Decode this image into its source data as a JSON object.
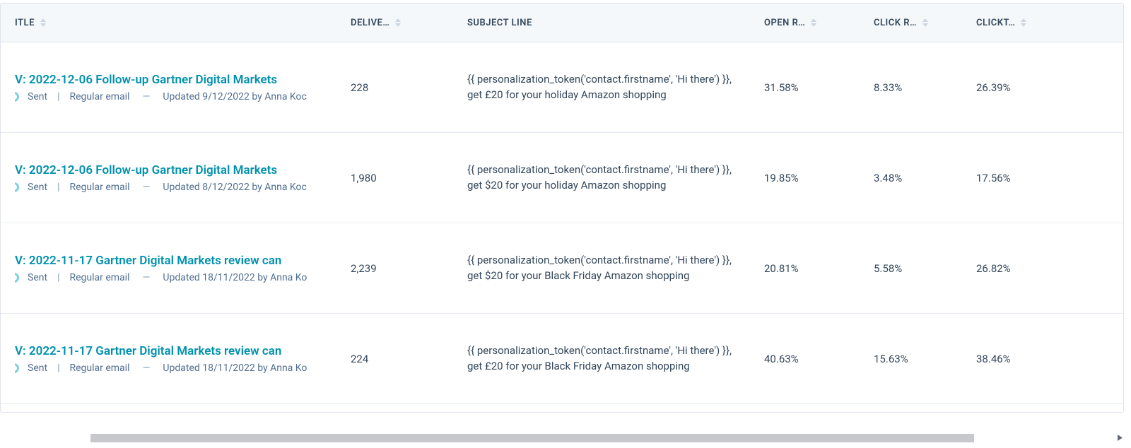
{
  "columns": {
    "title": "ITLE",
    "deliv": "DELIVE…",
    "subject": "SUBJECT LINE",
    "open": "OPEN R…",
    "click": "CLICK R…",
    "clickt": "CLICKT…"
  },
  "rows": [
    {
      "title": "V: 2022-12-06 Follow-up Gartner Digital Markets",
      "status": "Sent",
      "type": "Regular email",
      "updated": "Updated 9/12/2022 by Anna Koc",
      "delivered": "228",
      "subject": "{{ personalization_token('contact.firstname', 'Hi there') }}, get £20 for your holiday Amazon shopping",
      "open_rate": "31.58%",
      "click_rate": "8.33%",
      "clickthrough": "26.39%"
    },
    {
      "title": "V: 2022-12-06 Follow-up Gartner Digital Markets",
      "status": "Sent",
      "type": "Regular email",
      "updated": "Updated 8/12/2022 by Anna Koc",
      "delivered": "1,980",
      "subject": "{{ personalization_token('contact.firstname', 'Hi there') }}, get $20 for your holiday Amazon shopping",
      "open_rate": "19.85%",
      "click_rate": "3.48%",
      "clickthrough": "17.56%"
    },
    {
      "title": "V: 2022-11-17 Gartner Digital Markets review can",
      "status": "Sent",
      "type": "Regular email",
      "updated": "Updated 18/11/2022 by Anna Ko",
      "delivered": "2,239",
      "subject": "{{ personalization_token('contact.firstname', 'Hi there') }}, get $20 for your Black Friday Amazon shopping",
      "open_rate": "20.81%",
      "click_rate": "5.58%",
      "clickthrough": "26.82%"
    },
    {
      "title": "V: 2022-11-17 Gartner Digital Markets review can",
      "status": "Sent",
      "type": "Regular email",
      "updated": "Updated 18/11/2022 by Anna Ko",
      "delivered": "224",
      "subject": "{{ personalization_token('contact.firstname', 'Hi there') }}, get £20 for your Black Friday Amazon shopping",
      "open_rate": "40.63%",
      "click_rate": "15.63%",
      "clickthrough": "38.46%"
    }
  ]
}
